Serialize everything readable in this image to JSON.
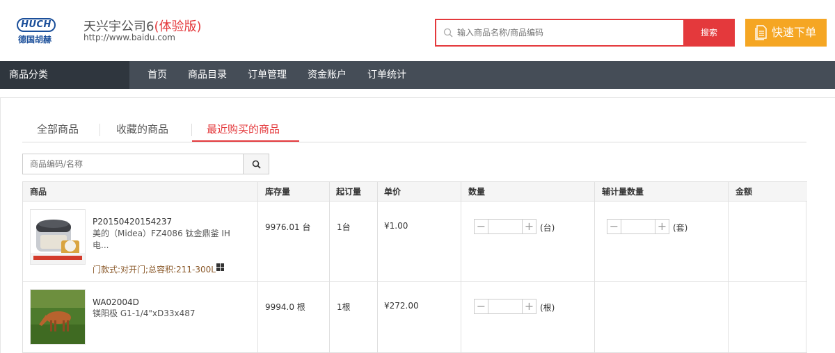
{
  "header": {
    "logo_text": "HUCH",
    "logo_cn": "德国胡赫",
    "company_name": "天兴宇公司6",
    "trial_label": "(体验版)",
    "company_url": "http://www.baidu.com",
    "search_placeholder": "输入商品名称/商品编码",
    "search_button": "搜索",
    "quick_order": "快速下单"
  },
  "nav": {
    "category": "商品分类",
    "items": [
      "首页",
      "商品目录",
      "订单管理",
      "资金账户",
      "订单统计"
    ]
  },
  "tabs": [
    {
      "label": "全部商品",
      "active": false
    },
    {
      "label": "收藏的商品",
      "active": false
    },
    {
      "label": "最近购买的商品",
      "active": true
    }
  ],
  "filter": {
    "placeholder": "商品编码/名称"
  },
  "table": {
    "headers": [
      "商品",
      "库存量",
      "起订量",
      "单价",
      "数量",
      "辅计量数量",
      "金额"
    ],
    "rows": [
      {
        "code": "P20150420154237",
        "name": "美的（Midea）FZ4086 钛金鼎釜 IH 电...",
        "spec": "门款式:对开门;总容积:211-300L",
        "stock": "9976.01 台",
        "moq": "1台",
        "price": "¥1.00",
        "qty_unit": "(台)",
        "aux_unit": "(套)",
        "amount": ""
      },
      {
        "code": "WA02004D",
        "name": "镁阳极 G1-1/4\"xD33x487",
        "spec": "",
        "stock": "9994.0 根",
        "moq": "1根",
        "price": "¥272.00",
        "qty_unit": "(根)",
        "aux_unit": "",
        "amount": ""
      }
    ]
  },
  "colors": {
    "accent": "#e4393c",
    "quick_order": "#f5a623",
    "nav_bg": "#454d57",
    "nav_cat_bg": "#2f363e"
  }
}
